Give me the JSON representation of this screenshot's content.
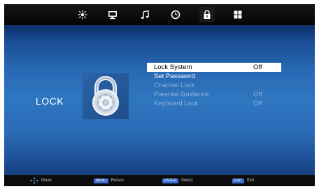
{
  "colors": {
    "selected_bg": "#ffffff",
    "text": "#ffffff",
    "disabled_text": "#8fb3dc",
    "keycap_bg": "#3a6fd0"
  },
  "tabs": [
    {
      "icon": "picture-sun-icon",
      "active": false
    },
    {
      "icon": "monitor-icon",
      "active": false
    },
    {
      "icon": "music-note-icon",
      "active": false
    },
    {
      "icon": "clock-icon",
      "active": false
    },
    {
      "icon": "padlock-icon",
      "active": true
    },
    {
      "icon": "grid-icon",
      "active": false
    }
  ],
  "page": {
    "title": "LOCK",
    "icon": "lock-dial-icon"
  },
  "menu": {
    "items": [
      {
        "label": "Lock System",
        "value": "Off",
        "state": "selected"
      },
      {
        "label": "Set Password",
        "value": "",
        "state": "normal"
      },
      {
        "label": "Channel Lock",
        "value": "",
        "state": "disabled"
      },
      {
        "label": "Parental Guidance",
        "value": "Off",
        "state": "disabled"
      },
      {
        "label": "Keyboard Lock",
        "value": "Off",
        "state": "disabled"
      }
    ]
  },
  "footer": {
    "move_label": "Move",
    "return_key": "MENU",
    "return_label": "Return",
    "select_key": "ENTER",
    "select_label": "Select",
    "exit_key": "EXIT",
    "exit_label": "Exit"
  }
}
